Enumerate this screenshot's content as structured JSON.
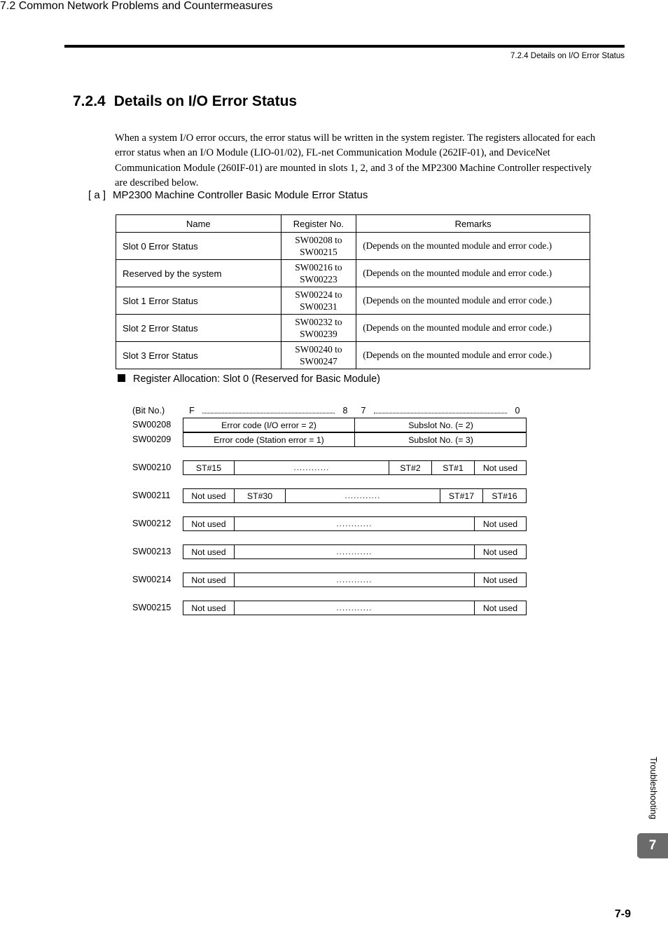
{
  "header": {
    "chapter_title": "7.2  Common Network Problems and Countermeasures",
    "section_title": "7.2.4  Details on I/O Error Status"
  },
  "section": {
    "number": "7.2.4",
    "title": "Details on I/O Error Status",
    "intro": "When a system I/O error occurs, the error status will be written in the system register. The registers allocated for each error status when an I/O Module (LIO-01/02), FL-net Communication Module (262IF-01), and DeviceNet Communication Module (260IF-01) are mounted in slots 1, 2, and 3 of the MP2300 Machine Controller respectively are described below."
  },
  "subsection": {
    "tag": "[ a ]",
    "title": "MP2300 Machine Controller Basic Module Error Status"
  },
  "error_status_table": {
    "headers": [
      "Name",
      "Register No.",
      "Remarks"
    ],
    "rows": [
      {
        "name": "Slot 0 Error Status",
        "register_from": "SW00208 to",
        "register_to": "SW00215",
        "remarks": "(Depends on the mounted module and  error code.)"
      },
      {
        "name": "Reserved by the system",
        "register_from": "SW00216 to",
        "register_to": "SW00223",
        "remarks": "(Depends on the mounted module and error code.)"
      },
      {
        "name": "Slot 1 Error Status",
        "register_from": "SW00224 to",
        "register_to": "SW00231",
        "remarks": "(Depends on the mounted module and error code.)"
      },
      {
        "name": "Slot 2 Error Status",
        "register_from": "SW00232 to",
        "register_to": "SW00239",
        "remarks": "(Depends on the mounted module and error code.)"
      },
      {
        "name": "Slot 3 Error Status",
        "register_from": "SW00240 to",
        "register_to": "SW00247",
        "remarks": "(Depends on the mounted module and error code.)"
      }
    ]
  },
  "register_allocation": {
    "heading": "Register Allocation: Slot 0 (Reserved for Basic Module)",
    "bit_scale": {
      "label": "(Bit No.)",
      "bit_high_left": "F",
      "bit_high_right": "8",
      "bit_low_left": "7",
      "bit_low_right": "0"
    },
    "dots": "............",
    "registers": [
      {
        "label": "SW00208",
        "cells": [
          {
            "text": "Error code (I/O error = 2)",
            "width": "half"
          },
          {
            "text": "Subslot No. (= 2)",
            "width": "half"
          }
        ]
      },
      {
        "label": "SW00209",
        "cells": [
          {
            "text": "Error code (Station error = 1)",
            "width": "half"
          },
          {
            "text": "Subslot No. (= 3)",
            "width": "half"
          }
        ]
      },
      {
        "label": "SW00210",
        "cells": [
          {
            "text": "ST#15",
            "width": "nu"
          },
          {
            "text": "............",
            "width": "grow",
            "dots": true
          },
          {
            "text": "ST#2",
            "width": "st"
          },
          {
            "text": "ST#1",
            "width": "st"
          },
          {
            "text": "Not used",
            "width": "nu"
          }
        ]
      },
      {
        "label": "SW00211",
        "cells": [
          {
            "text": "Not used",
            "width": "nu"
          },
          {
            "text": "ST#30",
            "width": "nu"
          },
          {
            "text": "............",
            "width": "grow",
            "dots": true
          },
          {
            "text": "ST#17",
            "width": "st"
          },
          {
            "text": "ST#16",
            "width": "st"
          }
        ]
      },
      {
        "label": "SW00212",
        "cells": [
          {
            "text": "Not used",
            "width": "nu"
          },
          {
            "text": "............",
            "width": "grow",
            "dots": true
          },
          {
            "text": "Not used",
            "width": "nu"
          }
        ]
      },
      {
        "label": "SW00213",
        "cells": [
          {
            "text": "Not used",
            "width": "nu"
          },
          {
            "text": "............",
            "width": "grow",
            "dots": true
          },
          {
            "text": "Not used",
            "width": "nu"
          }
        ]
      },
      {
        "label": "SW00214",
        "cells": [
          {
            "text": "Not used",
            "width": "nu"
          },
          {
            "text": "............",
            "width": "grow",
            "dots": true
          },
          {
            "text": "Not used",
            "width": "nu"
          }
        ]
      },
      {
        "label": "SW00215",
        "cells": [
          {
            "text": "Not used",
            "width": "nu"
          },
          {
            "text": "............",
            "width": "grow",
            "dots": true
          },
          {
            "text": "Not used",
            "width": "nu"
          }
        ]
      }
    ]
  },
  "footer": {
    "side_tab_label": "Troubleshooting",
    "chapter_tab": "7",
    "page_number": "7-9"
  }
}
